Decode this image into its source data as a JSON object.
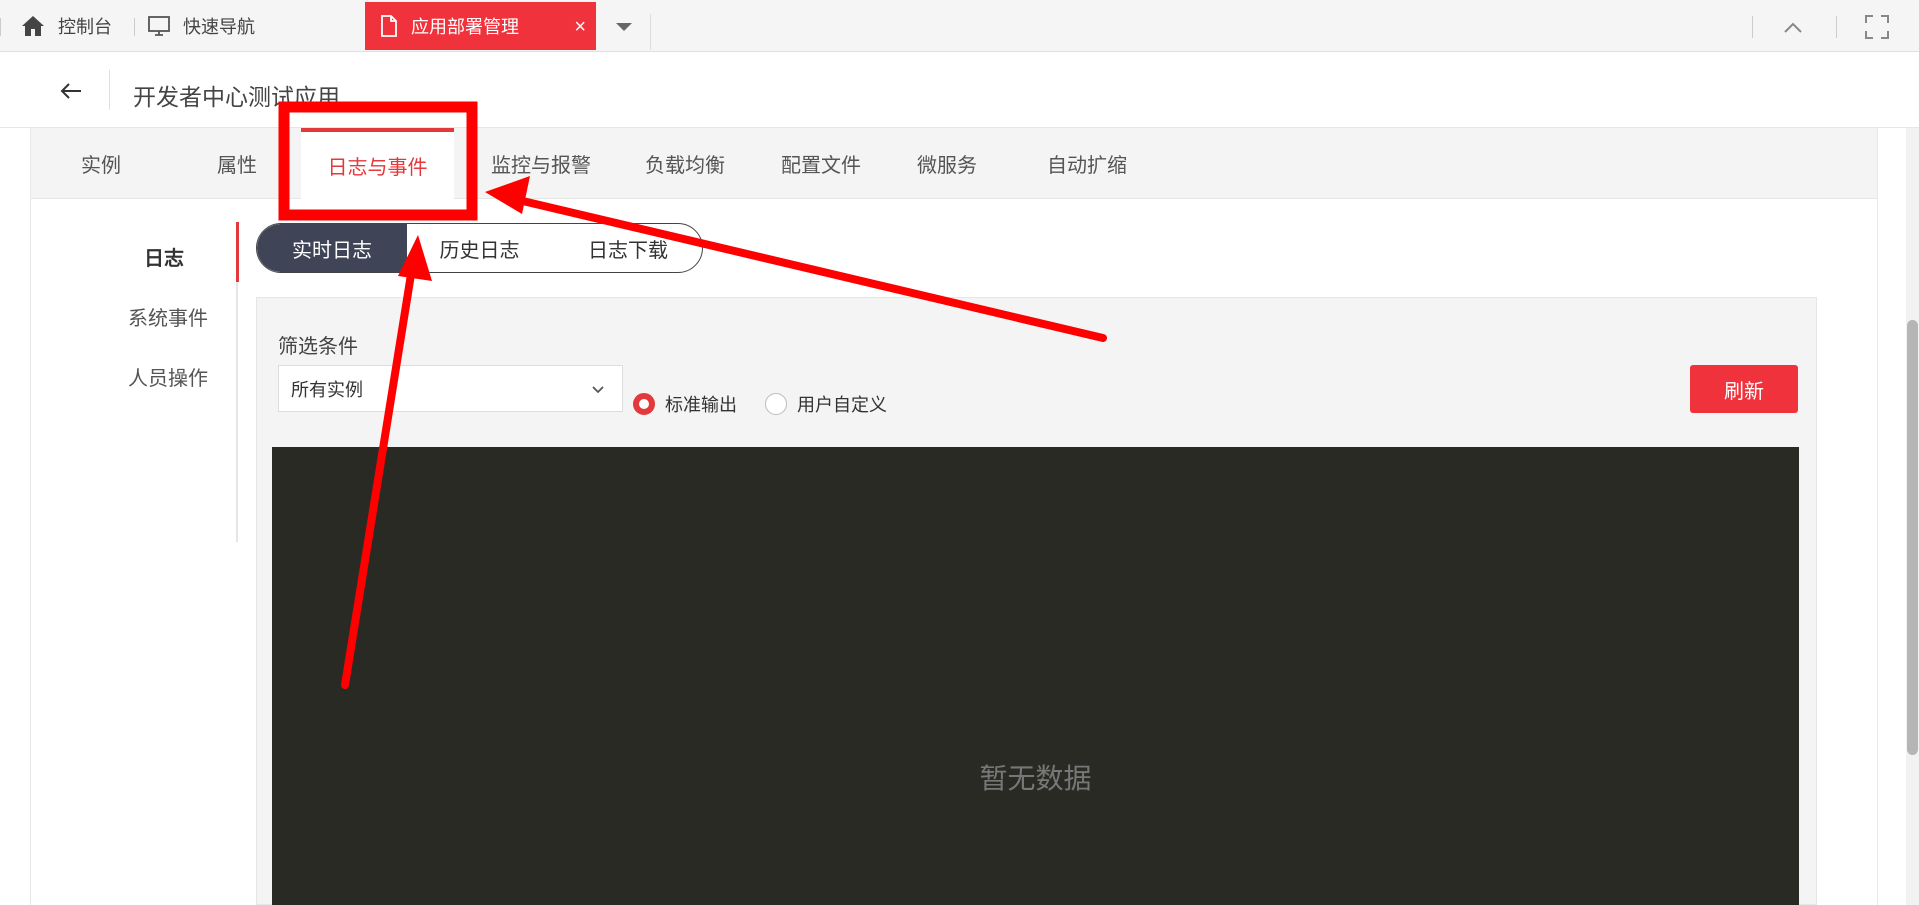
{
  "topbar": {
    "tabs": [
      {
        "label": "控制台",
        "icon": "home-icon"
      },
      {
        "label": "快速导航",
        "icon": "monitor-icon"
      }
    ],
    "active_tab": {
      "label": "应用部署管理",
      "icon": "document-icon",
      "close": "×"
    }
  },
  "header": {
    "title": "开发者中心测试应用"
  },
  "main_tabs": [
    "实例",
    "属性",
    "日志与事件",
    "监控与报警",
    "负载均衡",
    "配置文件",
    "微服务",
    "自动扩缩"
  ],
  "active_main_tab": "日志与事件",
  "subnav": [
    "日志",
    "系统事件",
    "人员操作"
  ],
  "segments": [
    "实时日志",
    "历史日志",
    "日志下载"
  ],
  "filter": {
    "label": "筛选条件",
    "instance_value": "所有实例",
    "radios": [
      {
        "label": "标准输出",
        "checked": true
      },
      {
        "label": "用户自定义",
        "checked": false
      }
    ],
    "refresh_label": "刷新"
  },
  "log": {
    "empty_text": "暂无数据"
  },
  "colors": {
    "accent": "#e4393c",
    "tab_active_bg": "#f0323c",
    "segment_active": "#3f4457",
    "log_bg": "#2a2a25",
    "annotation": "#ff0000"
  }
}
